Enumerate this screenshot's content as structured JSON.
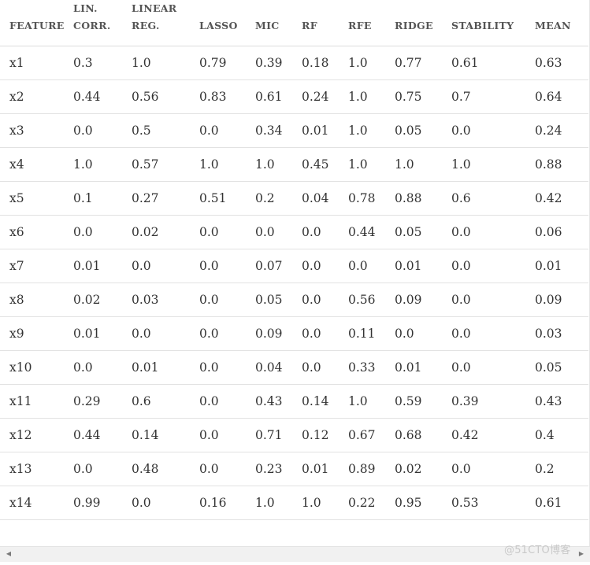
{
  "table": {
    "headers": [
      "FEATURE",
      "LIN. CORR.",
      "LINEAR REG.",
      "LASSO",
      "MIC",
      "RF",
      "RFE",
      "RIDGE",
      "STABILITY",
      "MEAN"
    ],
    "rows": [
      [
        "x1",
        "0.3",
        "1.0",
        "0.79",
        "0.39",
        "0.18",
        "1.0",
        "0.77",
        "0.61",
        "0.63"
      ],
      [
        "x2",
        "0.44",
        "0.56",
        "0.83",
        "0.61",
        "0.24",
        "1.0",
        "0.75",
        "0.7",
        "0.64"
      ],
      [
        "x3",
        "0.0",
        "0.5",
        "0.0",
        "0.34",
        "0.01",
        "1.0",
        "0.05",
        "0.0",
        "0.24"
      ],
      [
        "x4",
        "1.0",
        "0.57",
        "1.0",
        "1.0",
        "0.45",
        "1.0",
        "1.0",
        "1.0",
        "0.88"
      ],
      [
        "x5",
        "0.1",
        "0.27",
        "0.51",
        "0.2",
        "0.04",
        "0.78",
        "0.88",
        "0.6",
        "0.42"
      ],
      [
        "x6",
        "0.0",
        "0.02",
        "0.0",
        "0.0",
        "0.0",
        "0.44",
        "0.05",
        "0.0",
        "0.06"
      ],
      [
        "x7",
        "0.01",
        "0.0",
        "0.0",
        "0.07",
        "0.0",
        "0.0",
        "0.01",
        "0.0",
        "0.01"
      ],
      [
        "x8",
        "0.02",
        "0.03",
        "0.0",
        "0.05",
        "0.0",
        "0.56",
        "0.09",
        "0.0",
        "0.09"
      ],
      [
        "x9",
        "0.01",
        "0.0",
        "0.0",
        "0.09",
        "0.0",
        "0.11",
        "0.0",
        "0.0",
        "0.03"
      ],
      [
        "x10",
        "0.0",
        "0.01",
        "0.0",
        "0.04",
        "0.0",
        "0.33",
        "0.01",
        "0.0",
        "0.05"
      ],
      [
        "x11",
        "0.29",
        "0.6",
        "0.0",
        "0.43",
        "0.14",
        "1.0",
        "0.59",
        "0.39",
        "0.43"
      ],
      [
        "x12",
        "0.44",
        "0.14",
        "0.0",
        "0.71",
        "0.12",
        "0.67",
        "0.68",
        "0.42",
        "0.4"
      ],
      [
        "x13",
        "0.0",
        "0.48",
        "0.0",
        "0.23",
        "0.01",
        "0.89",
        "0.02",
        "0.0",
        "0.2"
      ],
      [
        "x14",
        "0.99",
        "0.0",
        "0.16",
        "1.0",
        "1.0",
        "0.22",
        "0.95",
        "0.53",
        "0.61"
      ]
    ]
  },
  "scrollbar": {
    "left_arrow_icon": "chevron-left-icon",
    "right_arrow_icon": "chevron-right-icon"
  },
  "watermark": {
    "text": "@51CTO博客"
  }
}
